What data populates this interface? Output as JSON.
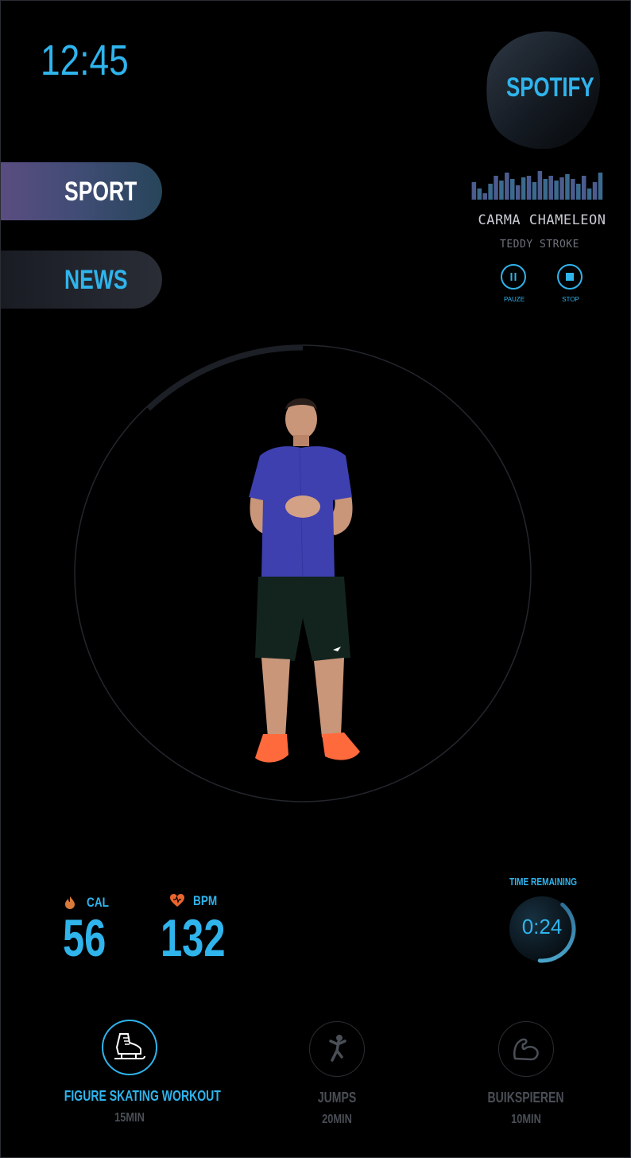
{
  "status": {
    "time": "12:45"
  },
  "nav": {
    "items": [
      {
        "label": "SPORT",
        "active": true
      },
      {
        "label": "NEWS",
        "active": false
      }
    ]
  },
  "player": {
    "service": "SPOTIFY",
    "track": "CARMA CHAMELEON",
    "artist": "TEDDY STROKE",
    "pause_label": "PAUZE",
    "stop_label": "STOP"
  },
  "stats": {
    "cal_label": "CAL",
    "cal_value": "56",
    "bpm_label": "BPM",
    "bpm_value": "132"
  },
  "timer": {
    "title": "TIME REMAINING",
    "value": "0:24",
    "progress": 0.4
  },
  "workout_progress": 0.12,
  "workouts": [
    {
      "name": "FIGURE SKATING WORKOUT",
      "duration": "15MIN",
      "active": true,
      "icon": "skate-icon"
    },
    {
      "name": "JUMPS",
      "duration": "20MIN",
      "active": false,
      "icon": "jump-icon"
    },
    {
      "name": "BUIKSPIEREN",
      "duration": "10MIN",
      "active": false,
      "icon": "muscle-icon"
    }
  ],
  "colors": {
    "accent": "#2fb4ec",
    "background": "#000000",
    "flame": "#d97a3a",
    "heart": "#e8652c",
    "muted": "#4a4e56"
  }
}
